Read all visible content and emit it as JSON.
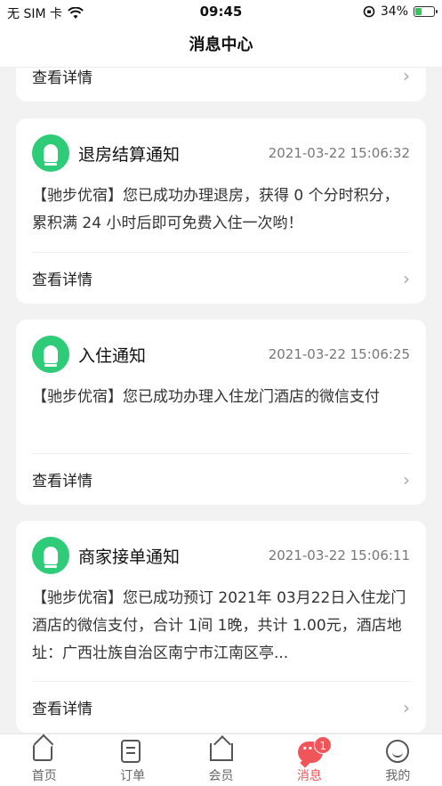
{
  "status_bar": {
    "carrier": "无 SIM 卡",
    "time": "09:45",
    "battery_pct": "34%",
    "battery_level": 0.34
  },
  "header": {
    "title": "消息中心"
  },
  "cards": [
    {
      "footer_label": "查看详情"
    },
    {
      "title": "退房结算通知",
      "time": "2021-03-22  15:06:32",
      "body": "【驰步优宿】您已成功办理退房，获得 0 个分时积分，累积满 24 小时后即可免费入住一次哟！",
      "footer_label": "查看详情"
    },
    {
      "title": "入住通知",
      "time": "2021-03-22  15:06:25",
      "body": "【驰步优宿】您已成功办理入住龙门酒店的微信支付",
      "footer_label": "查看详情"
    },
    {
      "title": "商家接单通知",
      "time": "2021-03-22  15:06:11",
      "body": "【驰步优宿】您已成功预订 2021年 03月22日入住龙门酒店的微信支付，合计 1间 1晚，共计 1.00元，酒店地址：广西壮族自治区南宁市江南区亭...",
      "footer_label": "查看详情"
    }
  ],
  "tabbar": {
    "items": [
      {
        "label": "首页",
        "icon": "home-icon"
      },
      {
        "label": "订单",
        "icon": "order-icon"
      },
      {
        "label": "会员",
        "icon": "crown-icon"
      },
      {
        "label": "消息",
        "icon": "chat-icon",
        "badge": "1",
        "active": true
      },
      {
        "label": "我的",
        "icon": "face-icon"
      }
    ]
  },
  "colors": {
    "accent": "#2ecb78",
    "active_tab": "#f0555a"
  }
}
